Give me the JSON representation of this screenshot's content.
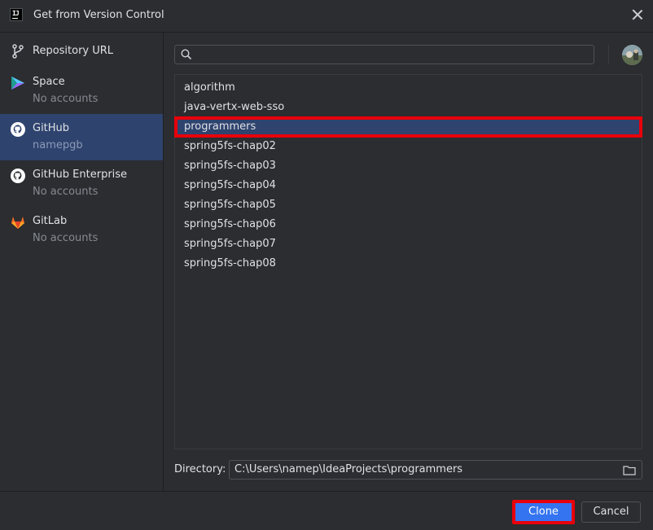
{
  "window": {
    "title": "Get from Version Control"
  },
  "sidebar": {
    "items": [
      {
        "label": "Repository URL",
        "sub": "",
        "icon": "branch-icon",
        "selected": false
      },
      {
        "label": "Space",
        "sub": "No accounts",
        "icon": "space-icon",
        "selected": false
      },
      {
        "label": "GitHub",
        "sub": "namepgb",
        "icon": "github-icon",
        "selected": true
      },
      {
        "label": "GitHub Enterprise",
        "sub": "No accounts",
        "icon": "github-icon",
        "selected": false
      },
      {
        "label": "GitLab",
        "sub": "No accounts",
        "icon": "gitlab-icon",
        "selected": false
      }
    ]
  },
  "search": {
    "value": "",
    "placeholder": ""
  },
  "repositories": [
    "algorithm",
    "java-vertx-web-sso",
    "programmers",
    "spring5fs-chap02",
    "spring5fs-chap03",
    "spring5fs-chap04",
    "spring5fs-chap05",
    "spring5fs-chap06",
    "spring5fs-chap07",
    "spring5fs-chap08"
  ],
  "selected_repository": "programmers",
  "directory": {
    "label": "Directory:",
    "value": "C:\\Users\\namep\\IdeaProjects\\programmers"
  },
  "buttons": {
    "clone": "Clone",
    "cancel": "Cancel"
  },
  "colors": {
    "accent": "#3574f0",
    "selection": "#2e436e",
    "highlight": "#e8000b",
    "background": "#2b2d30"
  }
}
